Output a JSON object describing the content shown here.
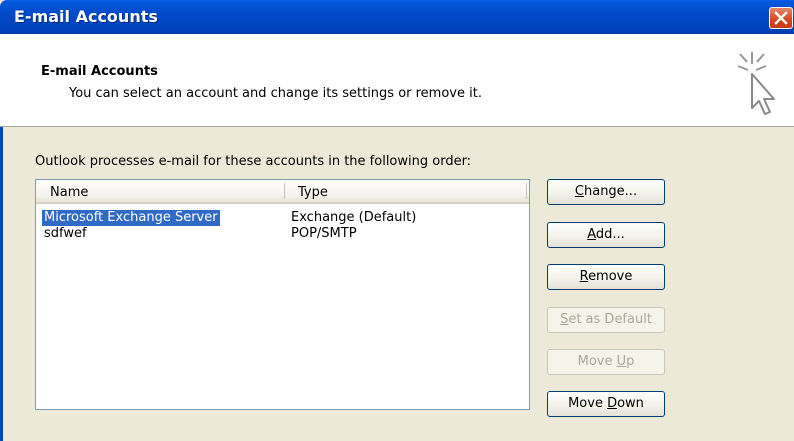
{
  "window": {
    "title": "E-mail Accounts",
    "close_icon": "close-icon",
    "accent": "#0046c0",
    "close_color": "#d7451c"
  },
  "header": {
    "title": "E-mail Accounts",
    "subtitle": "You can select an account and change its settings or remove it.",
    "icon": "sparkle-cursor-icon"
  },
  "accounts": {
    "label": "Outlook processes e-mail for these accounts in the following order:",
    "columns": [
      "Name",
      "Type"
    ],
    "rows": [
      {
        "name": "Microsoft Exchange Server",
        "type": "Exchange (Default)",
        "selected": true
      },
      {
        "name": "sdfwef",
        "type": "POP/SMTP",
        "selected": false
      }
    ],
    "selection_color": "#316ac5"
  },
  "buttons": {
    "change": {
      "pre": "",
      "key": "C",
      "post": "hange..."
    },
    "add": {
      "pre": "",
      "key": "A",
      "post": "dd..."
    },
    "remove": {
      "pre": "",
      "key": "R",
      "post": "emove"
    },
    "set_default": {
      "pre": "",
      "key": "S",
      "post": "et as Default",
      "disabled": true
    },
    "move_up": {
      "pre": "Move ",
      "key": "U",
      "post": "p",
      "disabled": true
    },
    "move_down": {
      "pre": "Move ",
      "key": "D",
      "post": "own"
    }
  }
}
